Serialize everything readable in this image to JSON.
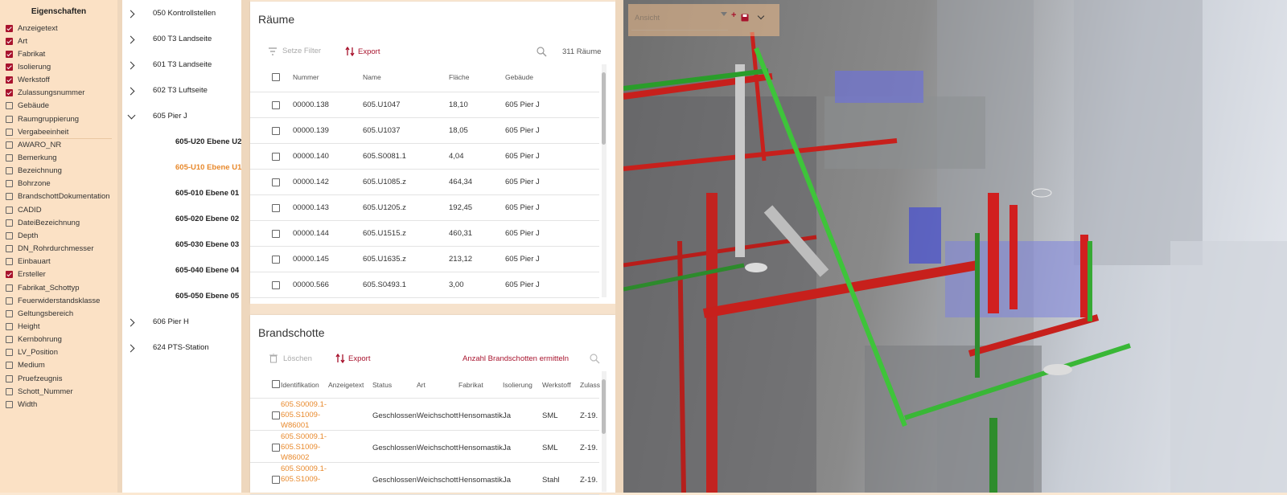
{
  "properties": {
    "title": "Eigenschaften",
    "items": [
      {
        "label": "Anzeigetext",
        "checked": true
      },
      {
        "label": "Art",
        "checked": true
      },
      {
        "label": "Fabrikat",
        "checked": true
      },
      {
        "label": "Isolierung",
        "checked": true
      },
      {
        "label": "Werkstoff",
        "checked": true
      },
      {
        "label": "Zulassungsnummer",
        "checked": true
      },
      {
        "label": "Gebäude",
        "checked": false
      },
      {
        "label": "Raumgruppierung",
        "checked": false
      },
      {
        "label": "Vergabeeinheit",
        "checked": false
      },
      {
        "label": "AWARO_NR",
        "checked": false
      },
      {
        "label": "Bemerkung",
        "checked": false
      },
      {
        "label": "Bezeichnung",
        "checked": false
      },
      {
        "label": "Bohrzone",
        "checked": false
      },
      {
        "label": "BrandschottDokumentation",
        "checked": false
      },
      {
        "label": "CADID",
        "checked": false
      },
      {
        "label": "DateiBezeichnung",
        "checked": false
      },
      {
        "label": "Depth",
        "checked": false
      },
      {
        "label": "DN_Rohrdurchmesser",
        "checked": false
      },
      {
        "label": "Einbauart",
        "checked": false
      },
      {
        "label": "Ersteller",
        "checked": true
      },
      {
        "label": "Fabrikat_Schottyp",
        "checked": false
      },
      {
        "label": "Feuerwiderstandsklasse",
        "checked": false
      },
      {
        "label": "Geltungsbereich",
        "checked": false
      },
      {
        "label": "Height",
        "checked": false
      },
      {
        "label": "Kernbohrung",
        "checked": false
      },
      {
        "label": "LV_Position",
        "checked": false
      },
      {
        "label": "Medium",
        "checked": false
      },
      {
        "label": "Pruefzeugnis",
        "checked": false
      },
      {
        "label": "Schott_Nummer",
        "checked": false
      },
      {
        "label": "Width",
        "checked": false
      }
    ]
  },
  "tree": {
    "nodes": [
      {
        "label": "050 Kontrollstellen",
        "expanded": false,
        "child": false,
        "selected": false
      },
      {
        "label": "600 T3 Landseite",
        "expanded": false,
        "child": false,
        "selected": false
      },
      {
        "label": "601 T3 Landseite",
        "expanded": false,
        "child": false,
        "selected": false
      },
      {
        "label": "602 T3 Luftseite",
        "expanded": false,
        "child": false,
        "selected": false
      },
      {
        "label": "605 Pier J",
        "expanded": true,
        "child": false,
        "selected": false
      },
      {
        "label": "605-U20 Ebene U2",
        "child": true,
        "selected": false
      },
      {
        "label": "605-U10 Ebene U1",
        "child": true,
        "selected": true
      },
      {
        "label": "605-010 Ebene 01",
        "child": true,
        "selected": false
      },
      {
        "label": "605-020 Ebene 02",
        "child": true,
        "selected": false
      },
      {
        "label": "605-030 Ebene 03",
        "child": true,
        "selected": false
      },
      {
        "label": "605-040 Ebene 04",
        "child": true,
        "selected": false
      },
      {
        "label": "605-050 Ebene 05",
        "child": true,
        "selected": false
      },
      {
        "label": "606 Pier H",
        "expanded": false,
        "child": false,
        "selected": false
      },
      {
        "label": "624 PTS-Station",
        "expanded": false,
        "child": false,
        "selected": false
      }
    ]
  },
  "rooms": {
    "title": "Räume",
    "filter_label": "Setze Filter",
    "export_label": "Export",
    "count_label": "311 Räume",
    "columns": [
      "Nummer",
      "Name",
      "Fläche",
      "Gebäude"
    ],
    "rows": [
      [
        "00000.138",
        "605.U1047",
        "18,10",
        "605 Pier J"
      ],
      [
        "00000.139",
        "605.U1037",
        "18,05",
        "605 Pier J"
      ],
      [
        "00000.140",
        "605.S0081.1",
        "4,04",
        "605 Pier J"
      ],
      [
        "00000.142",
        "605.U1085.z",
        "464,34",
        "605 Pier J"
      ],
      [
        "00000.143",
        "605.U1205.z",
        "192,45",
        "605 Pier J"
      ],
      [
        "00000.144",
        "605.U1515.z",
        "460,31",
        "605 Pier J"
      ],
      [
        "00000.145",
        "605.U1635.z",
        "213,12",
        "605 Pier J"
      ],
      [
        "00000.566",
        "605.S0493.1",
        "3,00",
        "605 Pier J"
      ]
    ]
  },
  "fire": {
    "title": "Brandschotte",
    "delete_label": "Löschen",
    "export_label": "Export",
    "count_action": "Anzahl Brandschotten ermitteln",
    "columns": [
      "Identifikation",
      "Anzeigetext",
      "Status",
      "Art",
      "Fabrikat",
      "Isolierung",
      "Werkstoff",
      "Zulass"
    ],
    "rows": [
      {
        "id_lines": [
          "605.S0009.1-",
          "605.S1009-",
          "W86001"
        ],
        "status": "Geschlossen",
        "art": "Weichschott",
        "fabrikat": "Hensomastik",
        "isolierung": "Ja",
        "werkstoff": "SML",
        "zul": "Z-19."
      },
      {
        "id_lines": [
          "605.S0009.1-",
          "605.S1009-",
          "W86002"
        ],
        "status": "Geschlossen",
        "art": "Weichschott",
        "fabrikat": "Hensomastik",
        "isolierung": "Ja",
        "werkstoff": "SML",
        "zul": "Z-19."
      },
      {
        "id_lines": [
          "605.S0009.1-",
          "605.S1009-",
          ""
        ],
        "status": "Geschlossen",
        "art": "Weichschott",
        "fabrikat": "Hensomastik",
        "isolierung": "Ja",
        "werkstoff": "Stahl",
        "zul": "Z-19."
      }
    ]
  },
  "view3d": {
    "view_placeholder": "Ansicht"
  },
  "colors": {
    "accent": "#a8132d",
    "orange": "#e8892c",
    "panel_bg": "#fbe1c5"
  },
  "icons": [
    "filter-icon",
    "export-icon",
    "search-icon",
    "trash-icon",
    "save-icon",
    "plus-icon",
    "chevron-down-icon",
    "chevron-right-icon",
    "checkbox-icon"
  ]
}
